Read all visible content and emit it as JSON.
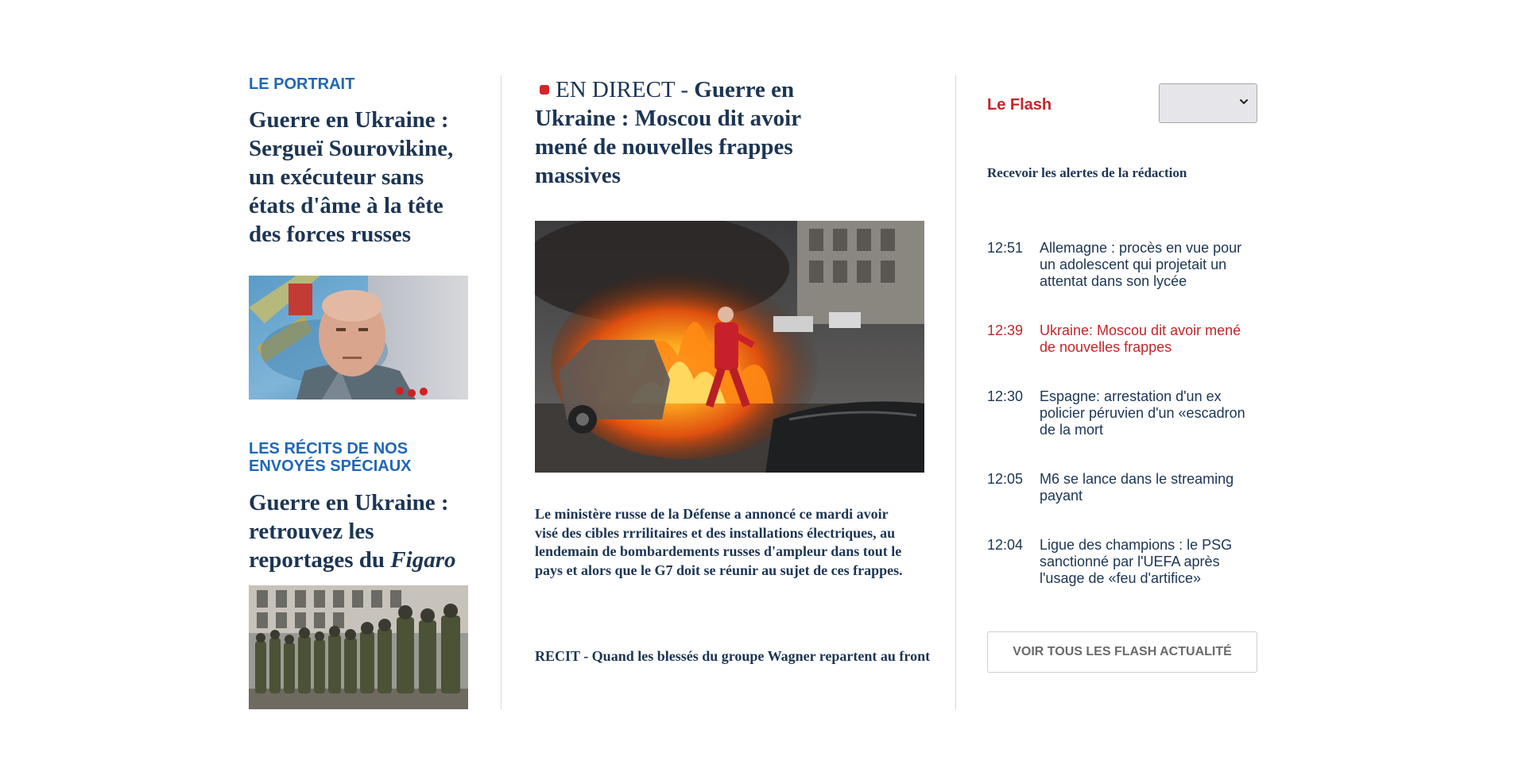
{
  "left": {
    "portrait": {
      "kicker": "LE PORTRAIT",
      "headline": "Guerre en Ukraine : Sergueï Sourovikine, un exécuteur sans états d'âme à la tête des forces russes"
    },
    "recits": {
      "kicker": "LES RÉCITS DE NOS ENVOYÉS SPÉCIAUX",
      "headline_prefix": "Guerre en Ukraine : retrouvez les reportages du ",
      "headline_emphasis": "Figaro"
    }
  },
  "main": {
    "live_label": "EN DIRECT -",
    "headline": " Guerre en Ukraine : Moscou dit avoir mené de nouvelles frappes massives",
    "summary": "Le ministère russe de la Défense a annoncé ce mardi avoir visé des cibles rrrilitaires et des installations électriques, au lendemain de bombardements russes d'ampleur dans tout le pays et alors que le G7 doit se réunir au sujet de ces frappes.",
    "related": "RECIT - Quand les blessés du groupe Wagner repartent au front"
  },
  "flash": {
    "title": "Le Flash",
    "alerts_link": "Recevoir les alertes de la rédaction",
    "items": [
      {
        "time": "12:51",
        "text": "Allemagne : procès en vue pour un adolescent qui projetait un attentat dans son lycée"
      },
      {
        "time": "12:39",
        "text": "Ukraine: Moscou dit avoir mené de nouvelles frappes"
      },
      {
        "time": "12:30",
        "text": "Espagne: arrestation d'un ex policier péruvien d'un «escadron de la mort"
      },
      {
        "time": "12:05",
        "text": "M6 se lance dans le streaming payant"
      },
      {
        "time": "12:04",
        "text": "Ligue des champions : le PSG sanctionné par l'UEFA après l'usage de «feu d'artifice»"
      }
    ],
    "see_all": "VOIR TOUS LES FLASH ACTUALITÉ"
  },
  "colors": {
    "kicker": "#2067b6",
    "headline": "#1c3554",
    "flash_accent": "#c2262a"
  }
}
